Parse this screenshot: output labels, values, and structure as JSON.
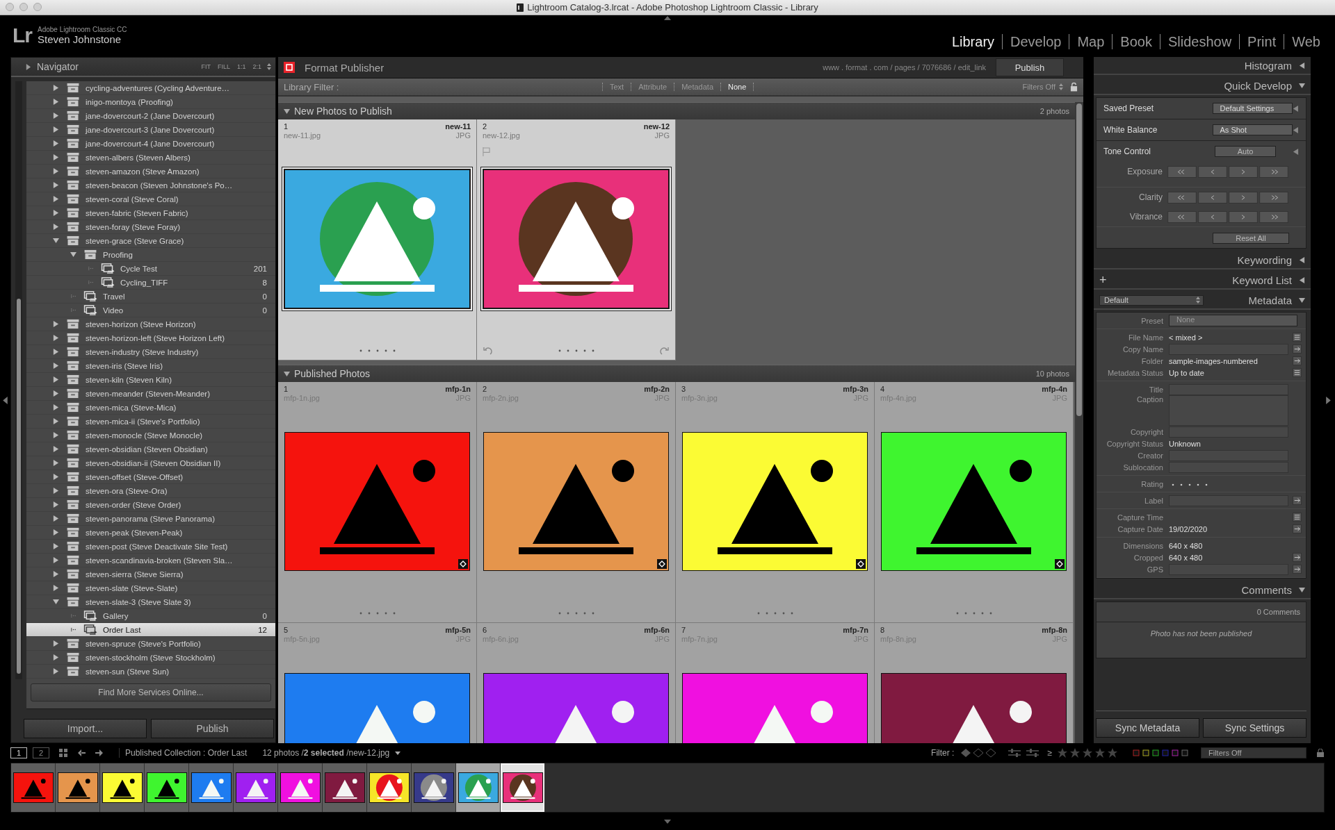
{
  "window": {
    "title": "Lightroom Catalog-3.lrcat - Adobe Photoshop Lightroom Classic - Library"
  },
  "identity": {
    "logo": "Lr",
    "app": "Adobe Lightroom Classic CC",
    "user": "Steven Johnstone"
  },
  "modules": [
    {
      "label": "Library",
      "selected": true
    },
    {
      "label": "Develop",
      "selected": false
    },
    {
      "label": "Map",
      "selected": false
    },
    {
      "label": "Book",
      "selected": false
    },
    {
      "label": "Slideshow",
      "selected": false
    },
    {
      "label": "Print",
      "selected": false
    },
    {
      "label": "Web",
      "selected": false
    }
  ],
  "left_panel": {
    "navigator": {
      "title": "Navigator",
      "expanded": false,
      "zoom_options": [
        "FIT",
        "FILL",
        "1:1",
        "2:1"
      ]
    },
    "services": [
      {
        "kind": "service",
        "label": "cycling-adventures (Cycling Adventure…",
        "expanded": false,
        "selected": false
      },
      {
        "kind": "service",
        "label": "inigo-montoya (Proofing)",
        "expanded": false,
        "selected": false
      },
      {
        "kind": "service",
        "label": "jane-dovercourt-2 (Jane Dovercourt)",
        "expanded": false,
        "selected": false
      },
      {
        "kind": "service",
        "label": "jane-dovercourt-3 (Jane Dovercourt)",
        "expanded": false,
        "selected": false
      },
      {
        "kind": "service",
        "label": "jane-dovercourt-4 (Jane Dovercourt)",
        "expanded": false,
        "selected": false
      },
      {
        "kind": "service",
        "label": "steven-albers (Steven Albers)",
        "expanded": false,
        "selected": false
      },
      {
        "kind": "service",
        "label": "steven-amazon (Steve Amazon)",
        "expanded": false,
        "selected": false
      },
      {
        "kind": "service",
        "label": "steven-beacon (Steven Johnstone's Po…",
        "expanded": false,
        "selected": false
      },
      {
        "kind": "service",
        "label": "steven-coral (Steve Coral)",
        "expanded": false,
        "selected": false
      },
      {
        "kind": "service",
        "label": "steven-fabric (Steven Fabric)",
        "expanded": false,
        "selected": false
      },
      {
        "kind": "service",
        "label": "steven-foray (Steve Foray)",
        "expanded": false,
        "selected": false
      },
      {
        "kind": "service",
        "label": "steven-grace (Steve Grace)",
        "expanded": true,
        "selected": false,
        "children": [
          {
            "kind": "set",
            "label": "Proofing",
            "expanded": true,
            "selected": false,
            "children": [
              {
                "kind": "collection",
                "label": "Cycle Test",
                "count": "201",
                "selected": false
              },
              {
                "kind": "collection",
                "label": "Cycling_TIFF",
                "count": "8",
                "selected": false
              }
            ]
          },
          {
            "kind": "collection",
            "label": "Travel",
            "count": "0",
            "selected": false
          },
          {
            "kind": "collection",
            "label": "Video",
            "count": "0",
            "selected": false
          }
        ]
      },
      {
        "kind": "service",
        "label": "steven-horizon (Steve Horizon)",
        "expanded": false,
        "selected": false
      },
      {
        "kind": "service",
        "label": "steven-horizon-left (Steve Horizon Left)",
        "expanded": false,
        "selected": false
      },
      {
        "kind": "service",
        "label": "steven-industry (Steve Industry)",
        "expanded": false,
        "selected": false
      },
      {
        "kind": "service",
        "label": "steven-iris (Steve Iris)",
        "expanded": false,
        "selected": false
      },
      {
        "kind": "service",
        "label": "steven-kiln (Steven Kiln)",
        "expanded": false,
        "selected": false
      },
      {
        "kind": "service",
        "label": "steven-meander (Steven-Meander)",
        "expanded": false,
        "selected": false
      },
      {
        "kind": "service",
        "label": "steven-mica (Steve-Mica)",
        "expanded": false,
        "selected": false
      },
      {
        "kind": "service",
        "label": "steven-mica-ii (Steve's Portfolio)",
        "expanded": false,
        "selected": false
      },
      {
        "kind": "service",
        "label": "steven-monocle (Steve Monocle)",
        "expanded": false,
        "selected": false
      },
      {
        "kind": "service",
        "label": "steven-obsidian (Steven Obsidian)",
        "expanded": false,
        "selected": false
      },
      {
        "kind": "service",
        "label": "steven-obsidian-ii (Steven Obsidian II)",
        "expanded": false,
        "selected": false
      },
      {
        "kind": "service",
        "label": "steven-offset (Steve-Offset)",
        "expanded": false,
        "selected": false
      },
      {
        "kind": "service",
        "label": "steven-ora (Steve-Ora)",
        "expanded": false,
        "selected": false
      },
      {
        "kind": "service",
        "label": "steven-order (Steve Order)",
        "expanded": false,
        "selected": false
      },
      {
        "kind": "service",
        "label": "steven-panorama (Steve Panorama)",
        "expanded": false,
        "selected": false
      },
      {
        "kind": "service",
        "label": "steven-peak (Steven-Peak)",
        "expanded": false,
        "selected": false
      },
      {
        "kind": "service",
        "label": "steven-post (Steve Deactivate Site Test)",
        "expanded": false,
        "selected": false
      },
      {
        "kind": "service",
        "label": "steven-scandinavia-broken (Steven Sla…",
        "expanded": false,
        "selected": false
      },
      {
        "kind": "service",
        "label": "steven-sierra (Steve Sierra)",
        "expanded": false,
        "selected": false
      },
      {
        "kind": "service",
        "label": "steven-slate (Steve-Slate)",
        "expanded": false,
        "selected": false
      },
      {
        "kind": "service",
        "label": "steven-slate-3 (Steve Slate 3)",
        "expanded": true,
        "selected": false,
        "children": [
          {
            "kind": "collection",
            "label": "Gallery",
            "count": "0",
            "selected": false
          },
          {
            "kind": "collection",
            "label": "Order Last",
            "count": "12",
            "selected": true
          }
        ]
      },
      {
        "kind": "service",
        "label": "steven-spruce (Steve's Portfolio)",
        "expanded": false,
        "selected": false
      },
      {
        "kind": "service",
        "label": "steven-stockholm (Steve Stockholm)",
        "expanded": false,
        "selected": false
      },
      {
        "kind": "service",
        "label": "steven-sun (Steve Sun)",
        "expanded": false,
        "selected": false
      }
    ],
    "find_more": "Find More Services Online...",
    "buttons": [
      "Import...",
      "Publish"
    ]
  },
  "publisher": {
    "title": "Format Publisher",
    "url": "www . format . com / pages / 7076686 / edit_link",
    "button": "Publish"
  },
  "library_filter": {
    "label": "Library Filter :",
    "options": [
      {
        "label": "Text",
        "selected": false
      },
      {
        "label": "Attribute",
        "selected": false
      },
      {
        "label": "Metadata",
        "selected": false
      },
      {
        "label": "None",
        "selected": true
      }
    ],
    "preset": "Filters Off"
  },
  "sections": [
    {
      "kind": "new",
      "title": "New Photos to Publish",
      "count": "2 photos",
      "expanded": true,
      "photos": [
        {
          "index": "1",
          "name": "new-11",
          "file": "new-11.jpg",
          "format": "JPG",
          "selected": true,
          "active": false
        },
        {
          "index": "2",
          "name": "new-12",
          "file": "new-12.jpg",
          "format": "JPG",
          "selected": true,
          "active": true
        }
      ]
    },
    {
      "kind": "published",
      "title": "Published Photos",
      "count": "10 photos",
      "expanded": true,
      "photos": [
        {
          "index": "1",
          "name": "mfp-1n",
          "file": "mfp-1n.jpg",
          "format": "JPG",
          "selected": false,
          "active": false
        },
        {
          "index": "2",
          "name": "mfp-2n",
          "file": "mfp-2n.jpg",
          "format": "JPG",
          "selected": false,
          "active": false
        },
        {
          "index": "3",
          "name": "mfp-3n",
          "file": "mfp-3n.jpg",
          "format": "JPG",
          "selected": false,
          "active": false
        },
        {
          "index": "4",
          "name": "mfp-4n",
          "file": "mfp-4n.jpg",
          "format": "JPG",
          "selected": false,
          "active": false
        },
        {
          "index": "5",
          "name": "mfp-5n",
          "file": "mfp-5n.jpg",
          "format": "JPG",
          "selected": false,
          "active": false
        },
        {
          "index": "6",
          "name": "mfp-6n",
          "file": "mfp-6n.jpg",
          "format": "JPG",
          "selected": false,
          "active": false
        },
        {
          "index": "7",
          "name": "mfp-7n",
          "file": "mfp-7n.jpg",
          "format": "JPG",
          "selected": false,
          "active": false
        },
        {
          "index": "8",
          "name": "mfp-8n",
          "file": "mfp-8n.jpg",
          "format": "JPG",
          "selected": false,
          "active": false
        }
      ]
    }
  ],
  "right_panel": {
    "histogram": {
      "title": "Histogram",
      "expanded": false
    },
    "quick_develop": {
      "title": "Quick Develop",
      "expanded": true,
      "saved_preset": {
        "label": "Saved Preset",
        "value": "Default Settings"
      },
      "white_balance": {
        "label": "White Balance",
        "value": "As Shot"
      },
      "tone_control": {
        "label": "Tone Control",
        "button": "Auto"
      },
      "adjustments": [
        {
          "label": "Exposure"
        },
        {
          "label": "Clarity"
        },
        {
          "label": "Vibrance"
        }
      ],
      "reset": "Reset All"
    },
    "keywording": {
      "title": "Keywording",
      "expanded": false
    },
    "keyword_list": {
      "title": "Keyword List",
      "expanded": false,
      "add": "+"
    },
    "metadata": {
      "title": "Metadata",
      "expanded": true,
      "preset_menu": "Default",
      "preset": {
        "label": "Preset",
        "value": "None"
      },
      "groups": [
        [
          {
            "kind": "text",
            "label": "File Name",
            "value": "< mixed >",
            "has_list": true
          },
          {
            "kind": "field",
            "label": "Copy Name",
            "has_arrow": true
          },
          {
            "kind": "text",
            "label": "Folder",
            "value": "sample-images-numbered",
            "has_arrow": true
          },
          {
            "kind": "text",
            "label": "Metadata Status",
            "value": "Up to date",
            "has_list": true
          }
        ],
        [
          {
            "kind": "field",
            "label": "Title"
          },
          {
            "kind": "area",
            "label": "Caption"
          },
          {
            "kind": "field",
            "label": "Copyright"
          },
          {
            "kind": "select",
            "label": "Copyright Status",
            "value": "Unknown"
          },
          {
            "kind": "field",
            "label": "Creator"
          },
          {
            "kind": "field",
            "label": "Sublocation"
          }
        ],
        [
          {
            "kind": "rating",
            "label": "Rating"
          }
        ],
        [
          {
            "kind": "field",
            "label": "Label",
            "has_arrow": true
          }
        ],
        [
          {
            "kind": "text",
            "label": "Capture Time",
            "has_list": true
          },
          {
            "kind": "text",
            "label": "Capture Date",
            "value": "19/02/2020",
            "has_arrow": true
          }
        ],
        [
          {
            "kind": "text",
            "label": "Dimensions",
            "value": "640 x 480"
          },
          {
            "kind": "text",
            "label": "Cropped",
            "value": "640 x 480",
            "has_arrow": true
          },
          {
            "kind": "field",
            "label": "GPS",
            "has_arrow": true
          }
        ]
      ]
    },
    "comments": {
      "title": "Comments",
      "expanded": true,
      "count": "0 Comments",
      "message": "Photo has not been published"
    },
    "buttons": [
      "Sync Metadata",
      "Sync Settings"
    ]
  },
  "filmstrip": {
    "views": [
      {
        "label": "1",
        "selected": true
      },
      {
        "label": "2",
        "selected": false
      }
    ],
    "source": "Published Collection : Order Last",
    "status": "12 photos /**2 selected** /new-12.jpg",
    "filter_label": "Filter :",
    "rating_operator": "≥",
    "filter_preset": "Filters Off",
    "thumbnails": [
      {
        "selected": false,
        "active": false
      },
      {
        "selected": false,
        "active": false
      },
      {
        "selected": false,
        "active": false
      },
      {
        "selected": false,
        "active": false
      },
      {
        "selected": false,
        "active": false
      },
      {
        "selected": false,
        "active": false
      },
      {
        "selected": false,
        "active": false
      },
      {
        "selected": false,
        "active": false
      },
      {
        "selected": false,
        "active": false
      },
      {
        "selected": false,
        "active": false
      },
      {
        "selected": true,
        "active": false
      },
      {
        "selected": true,
        "active": true
      }
    ]
  }
}
